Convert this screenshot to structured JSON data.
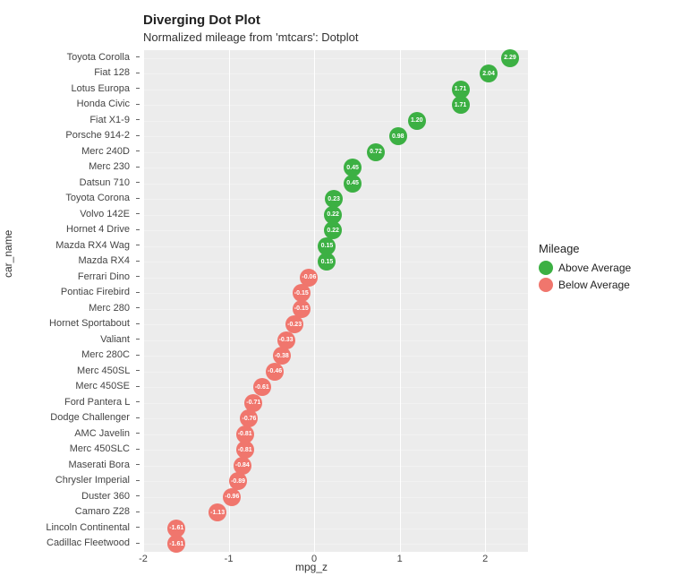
{
  "chart_data": {
    "type": "scatter",
    "title": "Diverging Dot Plot",
    "subtitle": "Normalized mileage from 'mtcars': Dotplot",
    "xlabel": "mpg_z",
    "ylabel": "car_name",
    "xlim": [
      -2,
      2.5
    ],
    "x_ticks": [
      -2,
      -1,
      0,
      1,
      2
    ],
    "legend_title": "Mileage",
    "legend_items": [
      {
        "label": "Above Average",
        "color": "#3cb043"
      },
      {
        "label": "Below Average",
        "color": "#f0766d"
      }
    ],
    "colors": {
      "above": "#3cb043",
      "below": "#f0766d"
    },
    "series": [
      {
        "car": "Toyota Corolla",
        "mpg_z": 2.29,
        "group": "above"
      },
      {
        "car": "Fiat 128",
        "mpg_z": 2.04,
        "group": "above"
      },
      {
        "car": "Lotus Europa",
        "mpg_z": 1.71,
        "group": "above"
      },
      {
        "car": "Honda Civic",
        "mpg_z": 1.71,
        "group": "above"
      },
      {
        "car": "Fiat X1-9",
        "mpg_z": 1.2,
        "group": "above"
      },
      {
        "car": "Porsche 914-2",
        "mpg_z": 0.98,
        "group": "above"
      },
      {
        "car": "Merc 240D",
        "mpg_z": 0.72,
        "group": "above"
      },
      {
        "car": "Merc 230",
        "mpg_z": 0.45,
        "group": "above"
      },
      {
        "car": "Datsun 710",
        "mpg_z": 0.45,
        "group": "above"
      },
      {
        "car": "Toyota Corona",
        "mpg_z": 0.23,
        "group": "above"
      },
      {
        "car": "Volvo 142E",
        "mpg_z": 0.22,
        "group": "above"
      },
      {
        "car": "Hornet 4 Drive",
        "mpg_z": 0.22,
        "group": "above"
      },
      {
        "car": "Mazda RX4 Wag",
        "mpg_z": 0.15,
        "group": "above"
      },
      {
        "car": "Mazda RX4",
        "mpg_z": 0.15,
        "group": "above"
      },
      {
        "car": "Ferrari Dino",
        "mpg_z": -0.06,
        "group": "below"
      },
      {
        "car": "Pontiac Firebird",
        "mpg_z": -0.15,
        "group": "below"
      },
      {
        "car": "Merc 280",
        "mpg_z": -0.15,
        "group": "below"
      },
      {
        "car": "Hornet Sportabout",
        "mpg_z": -0.23,
        "group": "below"
      },
      {
        "car": "Valiant",
        "mpg_z": -0.33,
        "group": "below"
      },
      {
        "car": "Merc 280C",
        "mpg_z": -0.38,
        "group": "below"
      },
      {
        "car": "Merc 450SL",
        "mpg_z": -0.46,
        "group": "below"
      },
      {
        "car": "Merc 450SE",
        "mpg_z": -0.61,
        "group": "below"
      },
      {
        "car": "Ford Pantera L",
        "mpg_z": -0.71,
        "group": "below"
      },
      {
        "car": "Dodge Challenger",
        "mpg_z": -0.76,
        "group": "below"
      },
      {
        "car": "AMC Javelin",
        "mpg_z": -0.81,
        "group": "below"
      },
      {
        "car": "Merc 450SLC",
        "mpg_z": -0.81,
        "group": "below"
      },
      {
        "car": "Maserati Bora",
        "mpg_z": -0.84,
        "group": "below"
      },
      {
        "car": "Chrysler Imperial",
        "mpg_z": -0.89,
        "group": "below"
      },
      {
        "car": "Duster 360",
        "mpg_z": -0.96,
        "group": "below"
      },
      {
        "car": "Camaro Z28",
        "mpg_z": -1.13,
        "group": "below"
      },
      {
        "car": "Lincoln Continental",
        "mpg_z": -1.61,
        "group": "below"
      },
      {
        "car": "Cadillac Fleetwood",
        "mpg_z": -1.61,
        "group": "below"
      }
    ]
  }
}
